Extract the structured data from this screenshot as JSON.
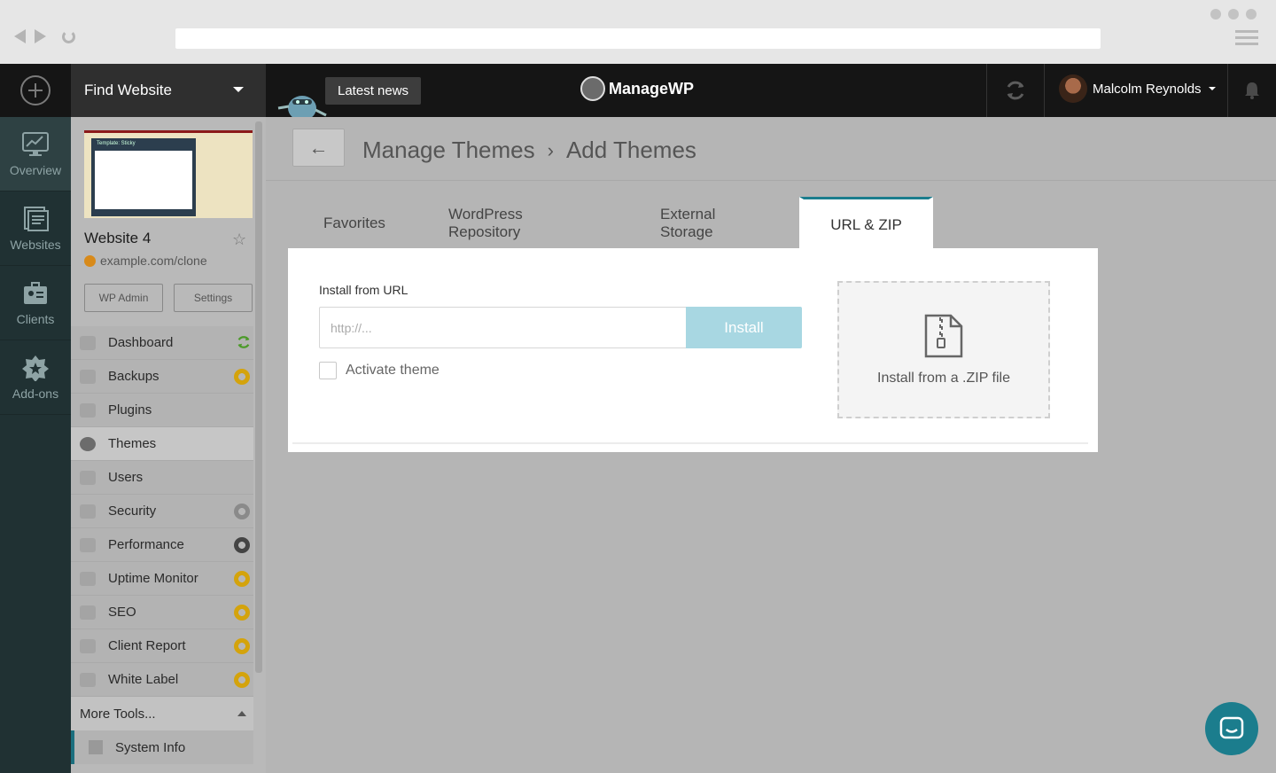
{
  "topbar": {
    "find_website": "Find Website",
    "news_label": "Latest news",
    "logo_text": "ManageWP",
    "user_name": "Malcolm Reynolds"
  },
  "leftnav": {
    "items": [
      {
        "label": "Overview",
        "icon": "monitor-chart-icon"
      },
      {
        "label": "Websites",
        "icon": "websites-icon"
      },
      {
        "label": "Clients",
        "icon": "clients-icon"
      },
      {
        "label": "Add-ons",
        "icon": "star-badge-icon"
      }
    ]
  },
  "website": {
    "thumb_title": "Template: Sticky",
    "name": "Website 4",
    "url": "example.com/clone",
    "wp_admin_label": "WP Admin",
    "settings_label": "Settings"
  },
  "menu": {
    "items": [
      {
        "label": "Dashboard",
        "badge": "sync"
      },
      {
        "label": "Backups",
        "badge": "gold"
      },
      {
        "label": "Plugins",
        "badge": ""
      },
      {
        "label": "Themes",
        "badge": "",
        "active": true
      },
      {
        "label": "Users",
        "badge": ""
      },
      {
        "label": "Security",
        "badge": "grey"
      },
      {
        "label": "Performance",
        "badge": "dark"
      },
      {
        "label": "Uptime Monitor",
        "badge": "gold"
      },
      {
        "label": "SEO",
        "badge": "gold"
      },
      {
        "label": "Client Report",
        "badge": "gold"
      },
      {
        "label": "White Label",
        "badge": "gold"
      }
    ],
    "more_tools": "More Tools...",
    "system_info": "System Info"
  },
  "breadcrumb": {
    "back": "←",
    "parent": "Manage Themes",
    "separator": "›",
    "current": "Add Themes"
  },
  "tabs": [
    {
      "label": "Favorites"
    },
    {
      "label": "WordPress Repository"
    },
    {
      "label": "External Storage"
    },
    {
      "label": "URL & ZIP",
      "active": true
    }
  ],
  "install": {
    "url_label": "Install from URL",
    "url_placeholder": "http://...",
    "install_button": "Install",
    "activate_label": "Activate theme",
    "activate_checked": false,
    "zip_label": "Install from a .ZIP file"
  },
  "colors": {
    "accent": "#1b7d8d",
    "install_button": "#a8d7e2",
    "badge_gold": "#d4a30c"
  }
}
